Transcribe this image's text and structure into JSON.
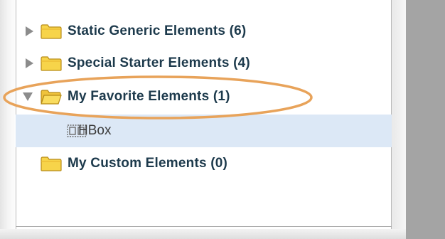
{
  "tree": {
    "items": [
      {
        "label": "Static Generic Elements (6)",
        "expanded": false,
        "icon": "folder-icon",
        "expander_icon": "triangle-right-icon"
      },
      {
        "label": "Special Starter Elements (4)",
        "expanded": false,
        "icon": "folder-icon",
        "expander_icon": "triangle-right-icon"
      },
      {
        "label": "My Favorite Elements (1)",
        "expanded": true,
        "icon": "folder-open-icon",
        "expander_icon": "triangle-down-icon",
        "highlighted": true,
        "children": [
          {
            "label": "HBox",
            "icon": "hbox-icon",
            "selected": true
          }
        ]
      },
      {
        "label": "My Custom Elements (0)",
        "expanded": false,
        "icon": "folder-icon"
      }
    ]
  },
  "colors": {
    "label_text": "#1d3a4c",
    "selected_row": "#dce8f6",
    "highlight_ellipse": "#e8a35a",
    "folder_fill": "#f7d44a",
    "right_pane": "#a4a4a4"
  }
}
